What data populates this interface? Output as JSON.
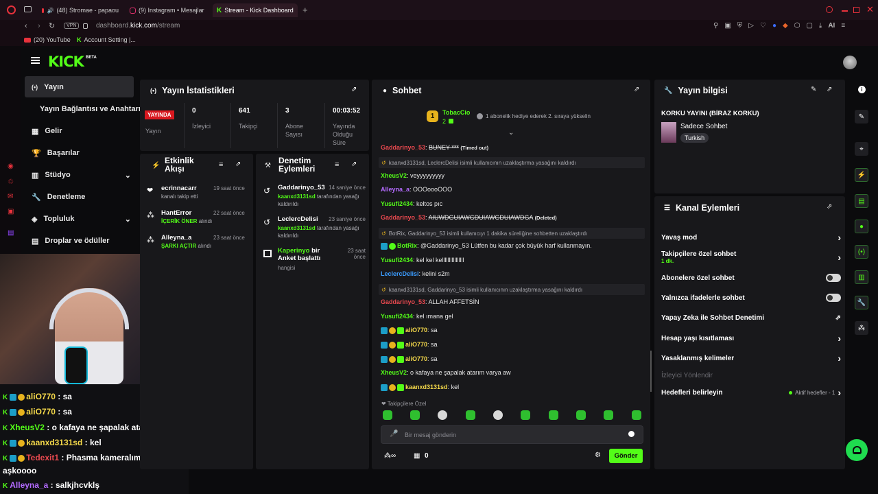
{
  "browser": {
    "tabs": [
      {
        "label": "(48) Stromae - papaou",
        "icon": "youtube-icon"
      },
      {
        "label": "(9) Instagram • Mesajlar",
        "icon": "instagram-icon"
      },
      {
        "label": "Stream - Kick Dashboard",
        "icon": "kick-icon"
      }
    ],
    "url_host": "dashboard.",
    "url_domain": "kick.com",
    "url_path": "/stream",
    "vpn": "VPN",
    "ai": "AI",
    "bookmarks": [
      "(20) YouTube",
      "Account Setting |..."
    ]
  },
  "kick": {
    "logo": "KICK",
    "beta": "BETA",
    "nav": [
      "Yayın",
      "Yayın Bağlantısı ve Anahtarı",
      "Gelir",
      "Başarılar",
      "Stüdyo",
      "Denetleme",
      "Topluluk",
      "Droplar ve ödüller"
    ]
  },
  "stats": {
    "title": "Yayın İstatistikleri",
    "live": "YAYINDA",
    "live_label": "Yayın",
    "items": [
      {
        "value": "0",
        "label": "İzleyici"
      },
      {
        "value": "641",
        "label": "Takipçi"
      },
      {
        "value": "3",
        "label": "Abone Sayısı"
      },
      {
        "value": "00:03:52",
        "label": "Yayında Olduğu Süre"
      }
    ]
  },
  "activity": {
    "title": "Etkinlik Akışı",
    "items": [
      {
        "user": "ecrinnacarr",
        "time": "19 saat önce",
        "desc": "kanalı takip etti",
        "hl": ""
      },
      {
        "user": "HantError",
        "time": "22 saat önce",
        "desc": "alındı",
        "hl": "İÇERİK ÖNER"
      },
      {
        "user": "Alleyna_a",
        "time": "23 saat önce",
        "desc": "alındı",
        "hl": "ŞARKI AÇTIR"
      }
    ]
  },
  "modactions": {
    "title": "Denetim Eylemleri",
    "items": [
      {
        "user": "Gaddarinyo_53",
        "time": "14 saniye önce",
        "actor": "kaanxd3131sd",
        "desc": "tarafından yasağı kaldırıldı"
      },
      {
        "user": "LeclercDelisi",
        "time": "23 saniye önce",
        "actor": "kaanxd3131sd",
        "desc": "tarafından yasağı kaldırıldı"
      }
    ],
    "poll_user": "Kaperinyo",
    "poll_text": "bir Anket başlattı",
    "poll_time": "23 saat önce",
    "poll_sub": "hangisi"
  },
  "chat": {
    "title": "Sohbet",
    "top_user": "TobacCio",
    "top_count": "2",
    "gift_text": "1 abonelik hediye ederek 2. sıraya yükselin",
    "lines": [
      {
        "user": "Gaddarinyo_53",
        "color": "#e8494f",
        "msg": "BUNEY ***",
        "suffix": "(Timed out)",
        "strike": true
      },
      {
        "sys": true,
        "text": "kaanxd3131sd, LeclercDelisi isimli kullanıcının uzaklaştırma yasağını kaldırdı"
      },
      {
        "user": "XheusV2",
        "color": "#53fc18",
        "msg": "veyyyyyyyyy"
      },
      {
        "user": "Alleyna_a",
        "color": "#b46bff",
        "msg": "OOOoooOOO"
      },
      {
        "user": "Yusufi2434",
        "color": "#53fc18",
        "msg": "keltos pıc"
      },
      {
        "user": "Gaddarinyo_53",
        "color": "#e8494f",
        "msg": "AIUWDGUIAWGDUIAWGDUIAWDGA",
        "suffix": "(Deleted)",
        "strike": true
      },
      {
        "sys": true,
        "text": "BotRix, Gaddarinyo_53 isimli kullanıcıyı 1 dakika süreliğine sohbetten uzaklaştırdı"
      },
      {
        "user": "BotRix",
        "color": "#53fc18",
        "msg": "@Gaddarinyo_53 Lütfen bu kadar çok büyük harf kullanmayın."
      },
      {
        "user": "Yusufi2434",
        "color": "#53fc18",
        "msg": "kel kel kellllllllllllllll"
      },
      {
        "user": "LeclercDelisi",
        "color": "#3b9cff",
        "msg": "kelini s2m"
      },
      {
        "sys": true,
        "text": "kaanxd3131sd, Gaddarinyo_53 isimli kullanıcının uzaklaştırma yasağını kaldırdı"
      },
      {
        "user": "Gaddarinyo_53",
        "color": "#e8494f",
        "msg": "ALLAH AFFETSİN"
      },
      {
        "user": "Yusufi2434",
        "color": "#53fc18",
        "msg": "kel ımana gel"
      },
      {
        "user": "aliO770",
        "color": "#f5d94a",
        "msg": "sa"
      },
      {
        "user": "aliO770",
        "color": "#f5d94a",
        "msg": "sa"
      },
      {
        "user": "aliO770",
        "color": "#f5d94a",
        "msg": "sa"
      },
      {
        "user": "XheusV2",
        "color": "#53fc18",
        "msg": "o kafaya ne şapalak atarım varya aw"
      },
      {
        "user": "kaanxd3131sd",
        "color": "#f5d94a",
        "msg": "kel"
      }
    ],
    "followers_only": "Takipçilere Özel",
    "placeholder": "Bir mesaj gönderin",
    "send": "Gönder",
    "count": "0"
  },
  "streaminfo": {
    "title": "Yayın bilgisi",
    "stream_title": "KORKU YAYINI (BİRAZ KORKU)",
    "category": "Sadece Sohbet",
    "tag": "Turkish"
  },
  "channel": {
    "title": "Kanal Eylemleri",
    "items": [
      {
        "label": "Yavaş mod",
        "type": "chevron"
      },
      {
        "label": "Takipçilere özel sohbet",
        "sub": "1 dk.",
        "type": "chevron"
      },
      {
        "label": "Abonelere özel sohbet",
        "type": "toggle"
      },
      {
        "label": "Yalnızca ifadelerle sohbet",
        "type": "toggle"
      },
      {
        "label": "Yapay Zeka ile Sohbet Denetimi",
        "type": "external"
      },
      {
        "label": "Hesap yaşı kısıtlaması",
        "type": "chevron"
      },
      {
        "label": "Yasaklanmış kelimeler",
        "type": "chevron"
      },
      {
        "label": "İzleyici Yönlendir",
        "type": "disabled"
      },
      {
        "label": "Hedefleri belirleyin",
        "type": "chevron",
        "status": "Aktif hedefler - 1"
      }
    ]
  },
  "overlay": {
    "lines": [
      {
        "user": "aliO770",
        "color": "#f5d94a",
        "msg": ": sa"
      },
      {
        "user": "aliO770",
        "color": "#f5d94a",
        "msg": ": sa"
      },
      {
        "user": "XheusV2",
        "color": "#53fc18",
        "msg": ": o kafaya ne şapalak atarım varya aw"
      },
      {
        "user": "kaanxd3131sd",
        "color": "#f5d94a",
        "msg": ": kel"
      },
      {
        "user": "Tedexit1",
        "color": "#e8494f",
        "msg": ": Phasma kameralımı olcak o"
      },
      {
        "user": "",
        "color": "#ffffff",
        "msg": "aşkoooo"
      },
      {
        "user": "Alleyna_a",
        "color": "#b46bff",
        "msg": ": salkjhcvklş"
      }
    ]
  }
}
